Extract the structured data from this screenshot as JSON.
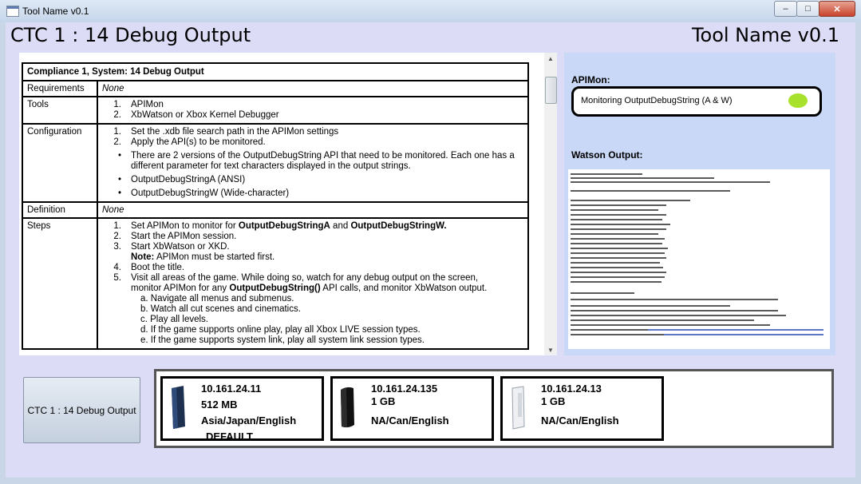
{
  "window": {
    "title": "Tool Name v0.1",
    "minimize": "–",
    "maximize": "□",
    "close": "✕"
  },
  "header": {
    "ctc_title": "CTC 1 : 14 Debug Output",
    "tool_title": "Tool Name v0.1"
  },
  "document": {
    "heading": "Compliance 1, System: 14 Debug Output",
    "rows": {
      "requirements": {
        "label": "Requirements",
        "value": "None"
      },
      "tools": {
        "label": "Tools",
        "items": [
          "APIMon",
          "XbWatson or Xbox Kernel Debugger"
        ]
      },
      "configuration": {
        "label": "Configuration",
        "items": [
          "Set the .xdb file search path in the APIMon settings",
          "Apply the API(s) to be monitored."
        ],
        "bullets": [
          "There are 2 versions of the OutputDebugString API that need to be monitored. Each one has a different parameter for text characters displayed in the output strings.",
          "OutputDebugStringA (ANSI)",
          "OutputDebugStringW (Wide-character)"
        ]
      },
      "definition": {
        "label": "Definition",
        "value": "None"
      },
      "steps": {
        "label": "Steps",
        "s1_pre": "Set APIMon to monitor for ",
        "s1_b1": "OutputDebugStringA",
        "s1_mid": " and ",
        "s1_b2": "OutputDebugStringW.",
        "s2": "Start the APIMon session.",
        "s3": "Start XbWatson or XKD.",
        "s3_note_b": "Note:",
        "s3_note": " APIMon must be started first.",
        "s4": "Boot the title.",
        "s5_a": "Visit all areas of the game. While doing so, watch for any debug output on the screen,",
        "s5_b_pre": "monitor APIMon for any ",
        "s5_b_bold": "OutputDebugString()",
        "s5_b_post": " API calls, and monitor XbWatson output.",
        "sub_a": "a.   Navigate all menus and submenus.",
        "sub_b": "b. Watch all cut scenes and cinematics.",
        "sub_c": "c. Play all levels.",
        "sub_d": "d. If the game supports online play, play all Xbox LIVE session types.",
        "sub_e": "e. If the game supports system link, play all system link session types."
      }
    }
  },
  "apimon": {
    "label": "APIMon:",
    "status": "Monitoring OutputDebugString (A & W)",
    "status_color": "#a7e12b"
  },
  "watson": {
    "label": "Watson Output:"
  },
  "bottom": {
    "debug_button": "CTC 1 : 14 Debug Output",
    "consoles": [
      {
        "ip": "10.161.24.11",
        "memory": "512 MB",
        "region": "Asia/Japan/English",
        "tag": "DEFAULT",
        "color": "dark-blue"
      },
      {
        "ip": "10.161.24.135",
        "memory": "1 GB",
        "region": "NA/Can/English",
        "tag": "",
        "color": "black"
      },
      {
        "ip": "10.161.24.13",
        "memory": "1 GB",
        "region": "NA/Can/English",
        "tag": "",
        "color": "white"
      }
    ]
  },
  "scroll": {
    "up": "▲",
    "down": "▼"
  }
}
